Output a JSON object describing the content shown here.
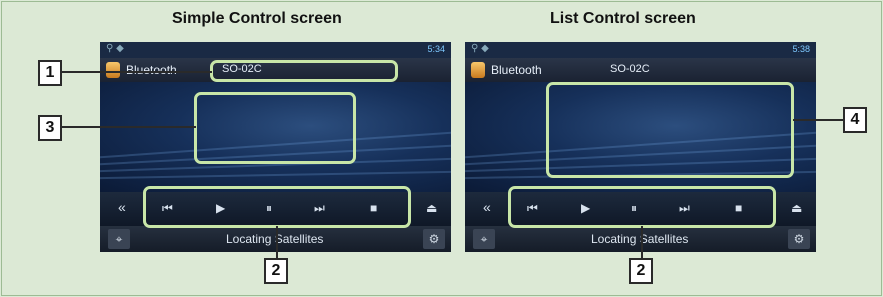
{
  "left": {
    "heading": "Simple Control screen",
    "status_time": "5:34",
    "source_label": "Bluetooth",
    "device_label": "SO-02C",
    "bottom_label": "Locating Satellites"
  },
  "right": {
    "heading": "List Control screen",
    "status_time": "5:38",
    "source_label": "Bluetooth",
    "device_label": "SO-02C",
    "bottom_label": "Locating Satellites"
  },
  "controls": {
    "back": "«",
    "prev": "⏮",
    "play": "▶",
    "pause": "⏸",
    "next": "⏭",
    "stop": "■",
    "eject": "⏏"
  },
  "callouts": [
    "1",
    "2",
    "3",
    "2",
    "4"
  ],
  "colors": {
    "background": "#dce9d5",
    "highlight": "#c8e6a8",
    "screen": "#0a1830"
  }
}
